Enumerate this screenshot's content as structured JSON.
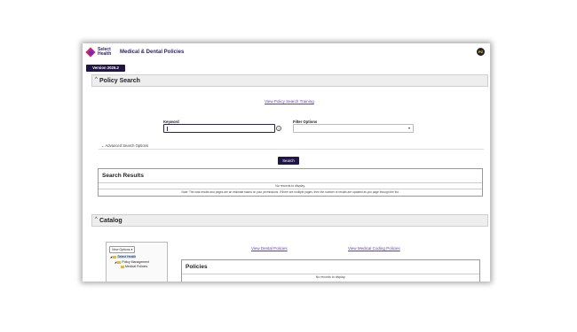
{
  "header": {
    "brand_line1": "Select",
    "brand_line2": "Health",
    "app_title": "Medical & Dental Policies",
    "avatar_initials": "PZ",
    "version": "Version 2026.2"
  },
  "policy_search": {
    "title": "Policy Search",
    "training_link": "View Policy Search Training",
    "keyword_label": "Keyword",
    "filter_label": "Filter Options",
    "help_symbol": "?",
    "advanced_label": "Advanced Search Options",
    "search_button": "Search"
  },
  "search_results": {
    "title": "Search Results",
    "no_records": "No records to display.",
    "note": "Note: The total results and pages are an estimate based on your permissions. If there are multiple pages, then the number of results are updated as you page through the list."
  },
  "catalog": {
    "title": "Catalog",
    "view_options": "View Options",
    "tree": [
      "Select Health",
      "Policy Management",
      "Medical Policies"
    ],
    "dental_link": "View Dental Policies",
    "medical_coding_link": "View Medical Coding Policies",
    "policies_title": "Policies",
    "policies_no_records": "No records to display."
  },
  "colors": {
    "brand": "#1f1547",
    "link": "#5a3fc0",
    "logo_pink": "#e0245e"
  }
}
